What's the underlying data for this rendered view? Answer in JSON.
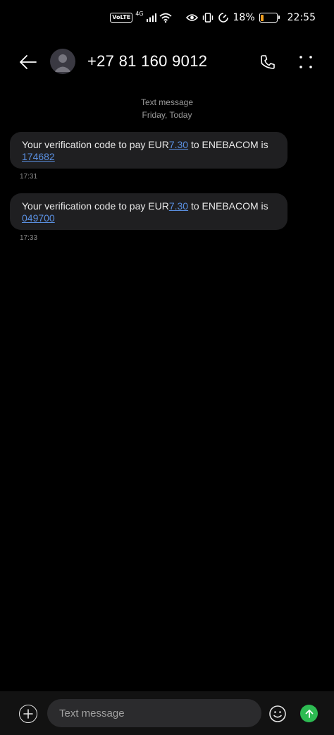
{
  "status_bar": {
    "volte": "VoLTE",
    "network": "4G",
    "battery_percent": "18%",
    "battery_level": 0.18,
    "time": "22:55",
    "battery_color": "#f0a020",
    "icons": [
      "volte-icon",
      "signal-icon",
      "wifi-icon",
      "eye-icon",
      "vibrate-icon",
      "data-saver-icon",
      "battery-icon"
    ]
  },
  "header": {
    "contact": "+27 81 160 9012",
    "icons": [
      "back-arrow-icon",
      "avatar",
      "phone-icon",
      "more-dots-icon"
    ]
  },
  "conversation": {
    "channel": "Text message",
    "day": "Friday, Today",
    "messages": [
      {
        "prefix": "Your verification code to pay EUR",
        "amount": "7.30",
        "middle": " to ENEBACOM is",
        "code": "174682",
        "time": "17:31"
      },
      {
        "prefix": "Your verification code to pay EUR",
        "amount": "7.30",
        "middle": " to ENEBACOM is",
        "code": "049700",
        "time": "17:33"
      }
    ]
  },
  "composer": {
    "placeholder": "Text message",
    "send_color": "#2dbb52",
    "icons": [
      "add-icon",
      "emoji-icon",
      "send-arrow-icon"
    ]
  },
  "colors": {
    "link": "#5a8fe0",
    "bubble": "#1f1f21",
    "background": "#000000"
  }
}
